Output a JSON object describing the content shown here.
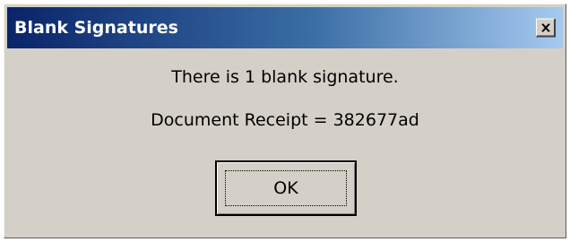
{
  "window": {
    "title": "Blank Signatures",
    "close_icon": "close-icon"
  },
  "message": {
    "line1": "There is 1 blank signature.",
    "line2": "Document Receipt = 382677ad"
  },
  "buttons": {
    "ok_label": "OK"
  },
  "colors": {
    "titlebar_start": "#0a246a",
    "titlebar_end": "#a6caf0",
    "dialog_bg": "#d4d0c8"
  }
}
